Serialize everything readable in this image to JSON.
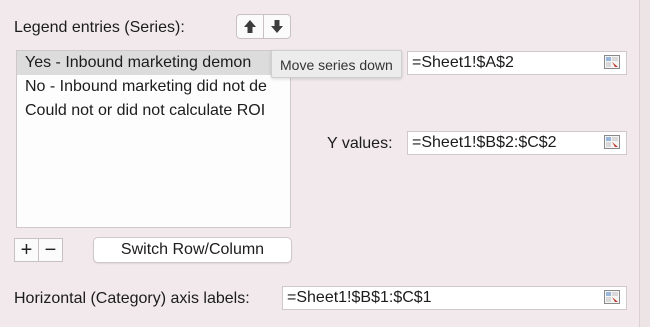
{
  "legend": {
    "label": "Legend entries (Series):",
    "move_up_icon": "arrow-up-icon",
    "move_down_icon": "arrow-down-icon",
    "series": [
      {
        "label": "Yes - Inbound marketing demon",
        "selected": true
      },
      {
        "label": "No - Inbound marketing did not de",
        "selected": false
      },
      {
        "label": "Could not or did not calculate ROI",
        "selected": false
      }
    ],
    "add_label": "+",
    "remove_label": "−",
    "switch_label": "Switch Row/Column"
  },
  "tooltip": {
    "text": "Move series down"
  },
  "series_detail": {
    "name_value": "=Sheet1!$A$2",
    "y_label": "Y values:",
    "y_value": "=Sheet1!$B$2:$C$2"
  },
  "category_axis": {
    "label": "Horizontal (Category) axis labels:",
    "value": "=Sheet1!$B$1:$C$1"
  },
  "colors": {
    "background": "#f1e9eb",
    "selection": "#dcdcdc"
  }
}
